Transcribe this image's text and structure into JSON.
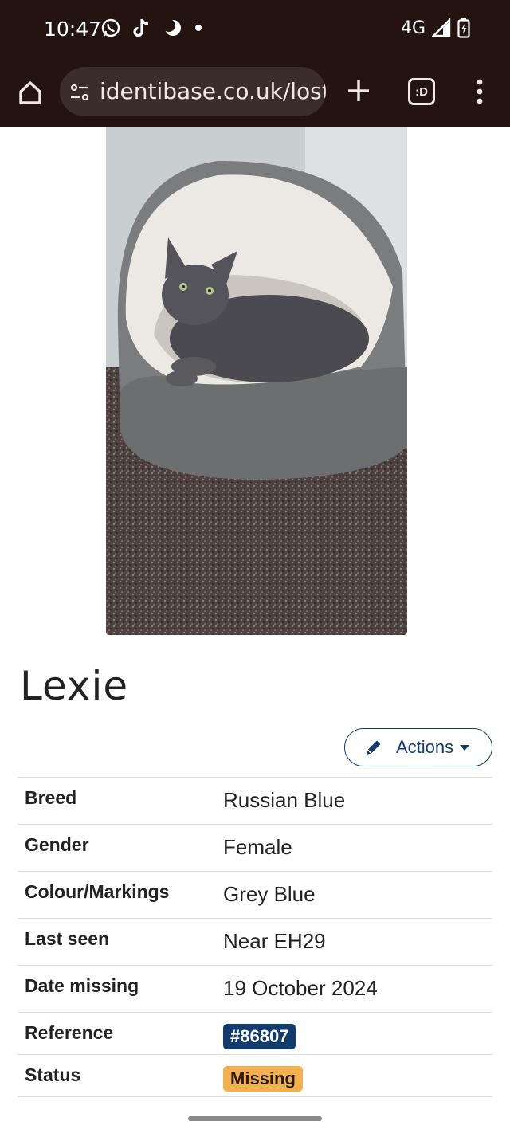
{
  "status_bar": {
    "time": "10:47",
    "network": "4G",
    "icons": [
      "whatsapp-icon",
      "tiktok-icon",
      "moon-icon",
      "dot-icon",
      "signal-icon",
      "battery-charging-icon"
    ]
  },
  "browser": {
    "url": "identibase.co.uk/lost-",
    "tabs_label": ":D",
    "icons": [
      "home-icon",
      "site-settings-icon",
      "plus-icon",
      "more-vert-icon"
    ]
  },
  "pet": {
    "name": "Lexie",
    "photo": "cat-in-bed-photo"
  },
  "actions": {
    "label": "Actions",
    "icon": "pencil-icon"
  },
  "details": {
    "rows": [
      {
        "label": "Breed",
        "value": "Russian Blue"
      },
      {
        "label": "Gender",
        "value": "Female"
      },
      {
        "label": "Colour/Markings",
        "value": "Grey Blue"
      },
      {
        "label": "Last seen",
        "value": "Near EH29"
      },
      {
        "label": "Date missing",
        "value": "19 October 2024"
      }
    ],
    "reference": {
      "label": "Reference",
      "value": "#86807"
    },
    "status": {
      "label": "Status",
      "value": "Missing"
    }
  },
  "colors": {
    "chrome_bg": "#23140f",
    "brand": "#123b6e",
    "status_badge": "#f2b04e"
  }
}
